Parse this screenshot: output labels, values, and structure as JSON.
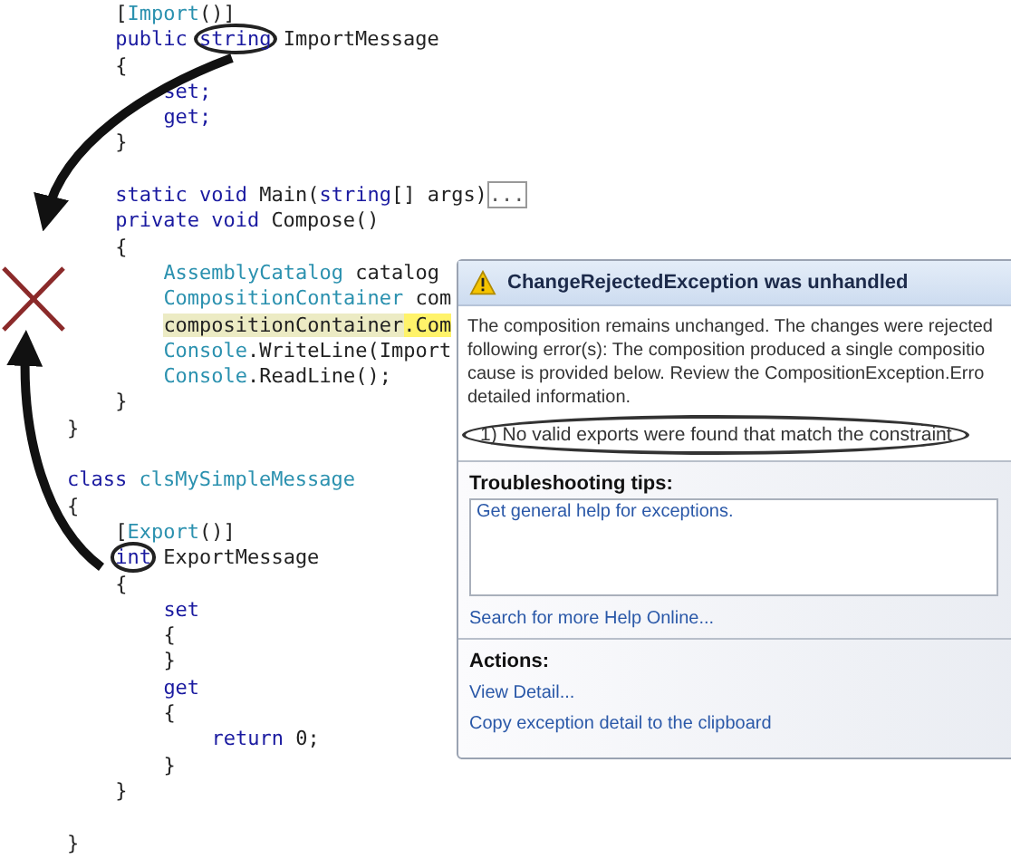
{
  "code": [
    {
      "children": [
        {
          "tokens": [
            {
              "text": "[",
              "kind": "plain"
            },
            {
              "text": "Import",
              "kind": "type"
            },
            {
              "text": "()]",
              "kind": "plain"
            }
          ]
        },
        {
          "tokens": [
            {
              "text": "public ",
              "kind": "kw"
            },
            {
              "text": "string",
              "kind": "kw",
              "circled": true
            },
            {
              "text": " ImportMessage",
              "kind": "plain"
            }
          ]
        },
        {
          "tokens": [
            {
              "text": "{",
              "kind": "plain"
            }
          ]
        },
        {
          "children": [
            {
              "tokens": [
                {
                  "text": "set;",
                  "kind": "kw"
                }
              ]
            },
            {
              "tokens": [
                {
                  "text": "get;",
                  "kind": "kw"
                }
              ]
            }
          ]
        },
        {
          "tokens": [
            {
              "text": "}",
              "kind": "plain"
            }
          ]
        },
        {
          "kind": "blank"
        },
        {
          "tokens": [
            {
              "text": "static void ",
              "kind": "kw"
            },
            {
              "text": "Main(",
              "kind": "plain"
            },
            {
              "text": "string",
              "kind": "kw"
            },
            {
              "text": "[] args)",
              "kind": "plain"
            },
            {
              "text": "...",
              "kind": "fold"
            }
          ]
        },
        {
          "tokens": [
            {
              "text": "private void ",
              "kind": "kw"
            },
            {
              "text": "Compose()",
              "kind": "plain"
            }
          ]
        },
        {
          "tokens": [
            {
              "text": "{",
              "kind": "plain"
            }
          ]
        },
        {
          "children": [
            {
              "tokens": [
                {
                  "text": "AssemblyCatalog",
                  "kind": "type"
                },
                {
                  "text": " catalog",
                  "kind": "plain"
                }
              ]
            },
            {
              "tokens": [
                {
                  "text": "CompositionContainer",
                  "kind": "type"
                },
                {
                  "text": " com",
                  "kind": "plain"
                }
              ]
            },
            {
              "tokens": [
                {
                  "text": "compositionContainer",
                  "kind": "highlight"
                },
                {
                  "text": ".Com",
                  "kind": "current"
                }
              ]
            },
            {
              "tokens": [
                {
                  "text": "Console",
                  "kind": "type"
                },
                {
                  "text": ".WriteLine(Import",
                  "kind": "plain"
                }
              ]
            },
            {
              "tokens": [
                {
                  "text": "Console",
                  "kind": "type"
                },
                {
                  "text": ".ReadLine();",
                  "kind": "plain"
                }
              ]
            }
          ]
        },
        {
          "tokens": [
            {
              "text": "}",
              "kind": "plain"
            }
          ]
        }
      ]
    },
    {
      "tokens": [
        {
          "text": "}",
          "kind": "plain"
        }
      ]
    },
    {
      "kind": "blank"
    },
    {
      "tokens": [
        {
          "text": "class ",
          "kind": "kw"
        },
        {
          "text": "clsMySimpleMessage",
          "kind": "type"
        }
      ]
    },
    {
      "tokens": [
        {
          "text": "{",
          "kind": "plain"
        }
      ]
    },
    {
      "children": [
        {
          "tokens": [
            {
              "text": "[",
              "kind": "plain"
            },
            {
              "text": "Export",
              "kind": "type"
            },
            {
              "text": "()]",
              "kind": "plain"
            }
          ]
        },
        {
          "tokens": [
            {
              "text": "int",
              "kind": "kw",
              "circled": true
            },
            {
              "text": " ExportMessage",
              "kind": "plain"
            }
          ]
        },
        {
          "tokens": [
            {
              "text": "{",
              "kind": "plain"
            }
          ]
        },
        {
          "children": [
            {
              "tokens": [
                {
                  "text": "set",
                  "kind": "kw"
                }
              ]
            },
            {
              "tokens": [
                {
                  "text": "{",
                  "kind": "plain"
                }
              ]
            },
            {
              "tokens": [
                {
                  "text": "}",
                  "kind": "plain"
                }
              ]
            },
            {
              "tokens": [
                {
                  "text": "get",
                  "kind": "kw"
                }
              ]
            },
            {
              "tokens": [
                {
                  "text": "{",
                  "kind": "plain"
                }
              ]
            },
            {
              "children": [
                {
                  "tokens": [
                    {
                      "text": "return ",
                      "kind": "kw"
                    },
                    {
                      "text": "0;",
                      "kind": "plain"
                    }
                  ]
                }
              ]
            },
            {
              "tokens": [
                {
                  "text": "}",
                  "kind": "plain"
                }
              ]
            }
          ]
        },
        {
          "tokens": [
            {
              "text": "}",
              "kind": "plain"
            }
          ]
        }
      ]
    },
    {
      "kind": "blank"
    },
    {
      "tokens": [
        {
          "text": "}",
          "kind": "plain"
        }
      ]
    }
  ],
  "dialog": {
    "title": "ChangeRejectedException was unhandled",
    "message_lines": [
      "The composition remains unchanged. The changes were rejected",
      "following error(s): The composition produced a single compositio",
      "cause is provided below. Review the CompositionException.Erro",
      "detailed information."
    ],
    "error": "1) No valid exports were found that match the constraint",
    "error_circled": true,
    "tips_heading": "Troubleshooting tips:",
    "tips": [
      "Get general help for exceptions."
    ],
    "search_link": "Search for more Help Online...",
    "actions_heading": "Actions:",
    "actions": [
      "View Detail...",
      "Copy exception detail to the clipboard"
    ]
  }
}
